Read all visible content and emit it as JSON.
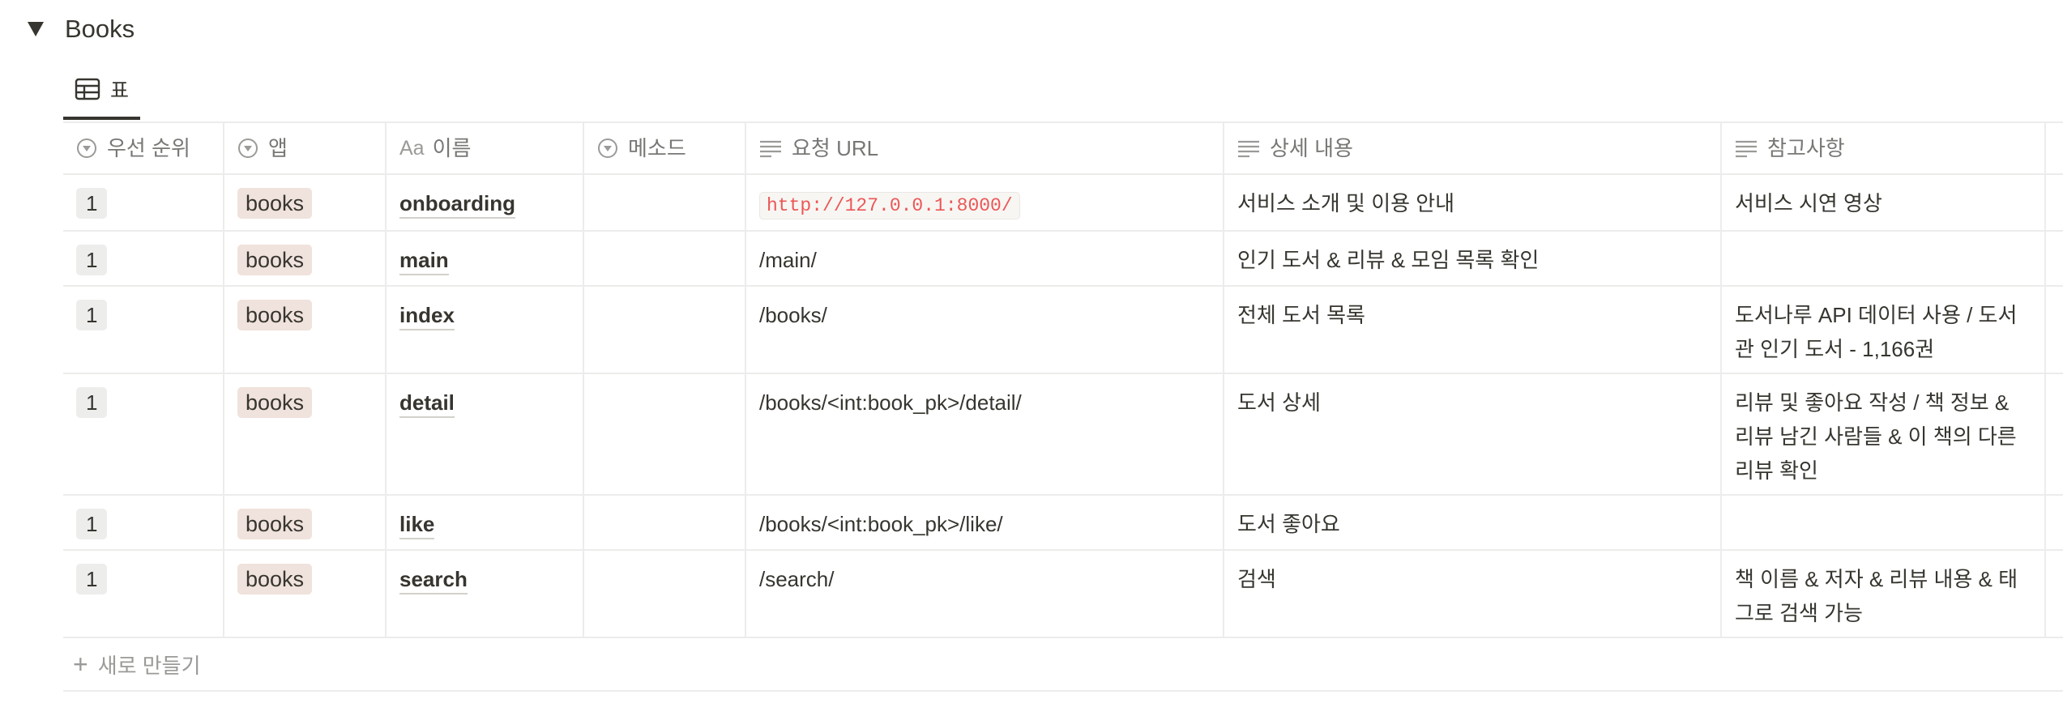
{
  "section": {
    "title": "Books"
  },
  "view_tab": {
    "label": "표"
  },
  "columns": [
    "우선 순위",
    "앱",
    "이름",
    "메소드",
    "요청 URL",
    "상세 내용",
    "참고사항"
  ],
  "rows": [
    {
      "priority": "1",
      "app": "books",
      "name": "onboarding",
      "method": "",
      "url": "http://127.0.0.1:8000/",
      "detail": "서비스 소개 및 이용 안내",
      "note": "서비스 시연 영상"
    },
    {
      "priority": "1",
      "app": "books",
      "name": "main",
      "method": "",
      "url": "/main/",
      "detail": "인기 도서 & 리뷰 & 모임 목록 확인",
      "note": ""
    },
    {
      "priority": "1",
      "app": "books",
      "name": "index",
      "method": "",
      "url": "/books/",
      "detail": "전체 도서 목록",
      "note": "도서나루 API 데이터 사용 / 도서관 인기 도서 - 1,166권"
    },
    {
      "priority": "1",
      "app": "books",
      "name": "detail",
      "method": "",
      "url": "/books/<int:book_pk>/detail/",
      "detail": "도서 상세",
      "note": "리뷰 및 좋아요 작성 / 책 정보 & 리뷰 남긴 사람들 & 이 책의 다른 리뷰 확인"
    },
    {
      "priority": "1",
      "app": "books",
      "name": "like",
      "method": "",
      "url": "/books/<int:book_pk>/like/",
      "detail": "도서 좋아요",
      "note": ""
    },
    {
      "priority": "1",
      "app": "books",
      "name": "search",
      "method": "",
      "url": "/search/",
      "detail": "검색",
      "note": "책 이름 & 저자 & 리뷰 내용 & 태그로 검색 가능"
    }
  ],
  "new_row": {
    "label": "새로 만들기"
  }
}
